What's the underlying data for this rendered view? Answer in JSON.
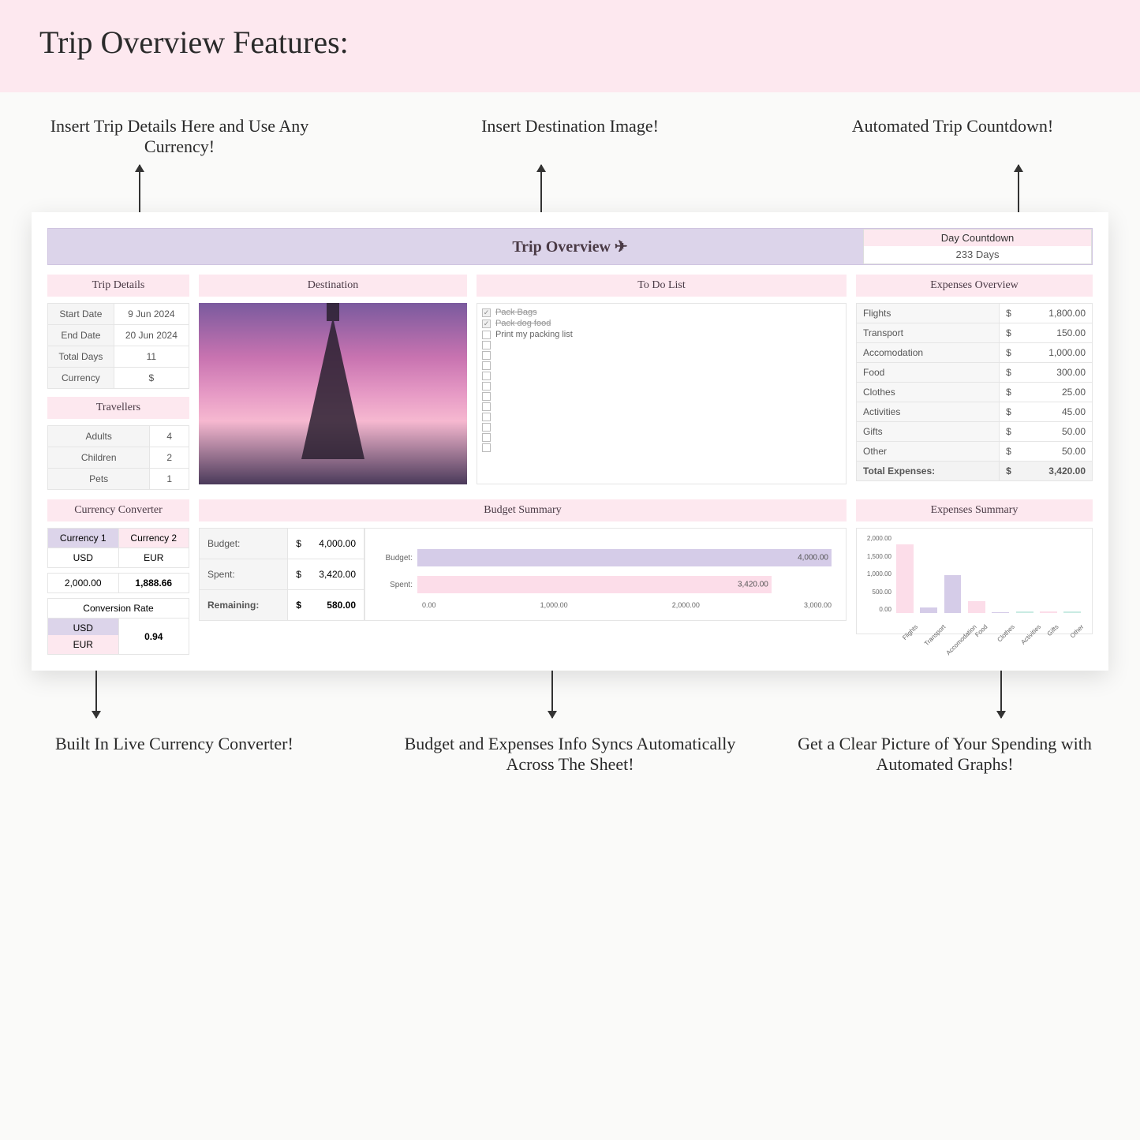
{
  "page_title": "Trip Overview Features:",
  "top_annotations": {
    "left": "Insert Trip Details Here and Use Any Currency!",
    "center": "Insert Destination Image!",
    "right": "Automated Trip Countdown!"
  },
  "bottom_annotations": {
    "left": "Built In Live Currency Converter!",
    "center": "Budget and Expenses Info Syncs Automatically Across The Sheet!",
    "right": "Get a Clear Picture of Your Spending with Automated Graphs!"
  },
  "title_bar": "Trip Overview ✈",
  "countdown": {
    "label": "Day Countdown",
    "value": "233  Days"
  },
  "headers": {
    "trip_details": "Trip Details",
    "destination": "Destination",
    "todo": "To Do List",
    "expenses_overview": "Expenses Overview",
    "travellers": "Travellers",
    "currency_converter": "Currency Converter",
    "budget_summary": "Budget Summary",
    "expenses_summary": "Expenses Summary",
    "conversion_rate": "Conversion Rate"
  },
  "trip_details": {
    "rows": [
      {
        "label": "Start Date",
        "value": "9 Jun 2024"
      },
      {
        "label": "End Date",
        "value": "20 Jun 2024"
      },
      {
        "label": "Total Days",
        "value": "11"
      },
      {
        "label": "Currency",
        "value": "$"
      }
    ]
  },
  "travellers": {
    "rows": [
      {
        "label": "Adults",
        "value": "4"
      },
      {
        "label": "Children",
        "value": "2"
      },
      {
        "label": "Pets",
        "value": "1"
      }
    ]
  },
  "todo": [
    {
      "text": "Pack Bags",
      "done": true
    },
    {
      "text": "Pack dog food",
      "done": true
    },
    {
      "text": "Print my packing list",
      "done": false
    }
  ],
  "expenses": {
    "rows": [
      {
        "label": "Flights",
        "value": "1,800.00"
      },
      {
        "label": "Transport",
        "value": "150.00"
      },
      {
        "label": "Accomodation",
        "value": "1,000.00"
      },
      {
        "label": "Food",
        "value": "300.00"
      },
      {
        "label": "Clothes",
        "value": "25.00"
      },
      {
        "label": "Activities",
        "value": "45.00"
      },
      {
        "label": "Gifts",
        "value": "50.00"
      },
      {
        "label": "Other",
        "value": "50.00"
      }
    ],
    "total_label": "Total Expenses:",
    "total_value": "3,420.00",
    "currency": "$"
  },
  "currency_converter": {
    "c1_label": "Currency 1",
    "c2_label": "Currency 2",
    "c1": "USD",
    "c2": "EUR",
    "amount1": "2,000.00",
    "amount2": "1,888.66",
    "rate_c1": "USD",
    "rate_c2": "EUR",
    "rate": "0.94"
  },
  "budget": {
    "rows": [
      {
        "label": "Budget:",
        "value": "4,000.00"
      },
      {
        "label": "Spent:",
        "value": "3,420.00"
      },
      {
        "label": "Remaining:",
        "value": "580.00"
      }
    ],
    "currency": "$"
  },
  "chart_data": [
    {
      "type": "bar",
      "orientation": "horizontal",
      "title": "Budget Summary",
      "categories": [
        "Budget:",
        "Spent:"
      ],
      "values": [
        4000.0,
        3420.0
      ],
      "colors": [
        "#d5cce8",
        "#fcdde9"
      ],
      "xlim": [
        0,
        4000
      ],
      "xticks": [
        "0.00",
        "1,000.00",
        "2,000.00",
        "3,000.00"
      ],
      "data_labels": [
        "4,000.00",
        "3,420.00"
      ]
    },
    {
      "type": "bar",
      "orientation": "vertical",
      "title": "Expenses Summary",
      "categories": [
        "Flights",
        "Transport",
        "Accomodation",
        "Food",
        "Clothes",
        "Activities",
        "Gifts",
        "Other"
      ],
      "values": [
        1800,
        150,
        1000,
        300,
        25,
        45,
        50,
        50
      ],
      "colors": [
        "#fcdde9",
        "#d5cce8",
        "#d5cce8",
        "#fcdde9",
        "#d5cce8",
        "#c9ebe3",
        "#fcdde9",
        "#c9ebe3"
      ],
      "ylim": [
        0,
        2000
      ],
      "yticks": [
        "2,000.00",
        "1,500.00",
        "1,000.00",
        "500.00",
        "0.00"
      ]
    }
  ]
}
